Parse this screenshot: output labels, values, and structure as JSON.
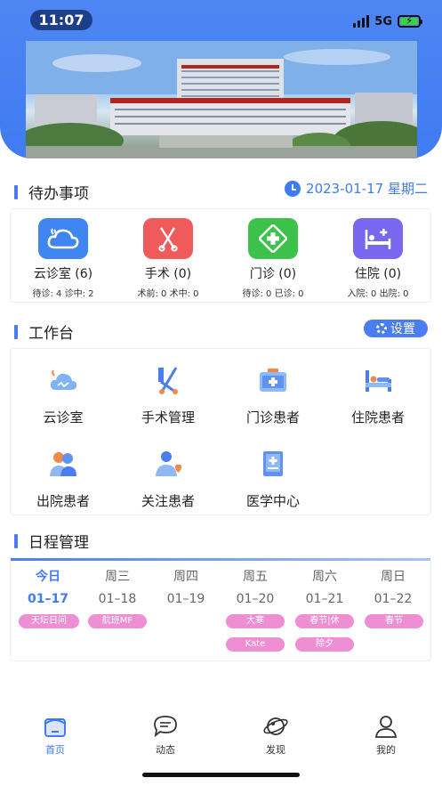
{
  "status_bar": {
    "time": "11:07",
    "network": "5G"
  },
  "todo": {
    "title": "待办事项",
    "date": "2023-01-17 星期二",
    "items": [
      {
        "name": "云诊室 (6)",
        "sub": "待诊: 4  诊中: 2",
        "color": "#3f86f3"
      },
      {
        "name": "手术 (0)",
        "sub": "术前: 0  术中: 0",
        "color": "#ef5b5b"
      },
      {
        "name": "门诊 (0)",
        "sub": "待诊: 0  已诊: 0",
        "color": "#3cc24a"
      },
      {
        "name": "住院 (0)",
        "sub": "入院: 0  出院: 0",
        "color": "#7a67f0"
      }
    ]
  },
  "workbench": {
    "title": "工作台",
    "settings_label": "设置",
    "items": [
      {
        "label": "云诊室",
        "icon": "cloud-icon"
      },
      {
        "label": "手术管理",
        "icon": "surgery-tools-icon"
      },
      {
        "label": "门诊患者",
        "icon": "medical-kit-icon"
      },
      {
        "label": "住院患者",
        "icon": "hospital-bed-icon"
      },
      {
        "label": "出院患者",
        "icon": "patients-icon"
      },
      {
        "label": "关注患者",
        "icon": "heart-patient-icon"
      },
      {
        "label": "医学中心",
        "icon": "medical-book-icon"
      }
    ]
  },
  "schedule": {
    "title": "日程管理",
    "days": [
      {
        "name": "今日",
        "date": "01–17",
        "today": true
      },
      {
        "name": "周三",
        "date": "01–18"
      },
      {
        "name": "周四",
        "date": "01–19"
      },
      {
        "name": "周五",
        "date": "01–20"
      },
      {
        "name": "周六",
        "date": "01–21"
      },
      {
        "name": "周日",
        "date": "01–22"
      }
    ],
    "tags": [
      "天坛日间",
      "航班MF",
      "大寒",
      "春节|休",
      "春节",
      "Kate",
      "除夕"
    ],
    "tag_color": "#ee8fd3"
  },
  "tabbar": {
    "items": [
      {
        "label": "首页",
        "active": true
      },
      {
        "label": "动态"
      },
      {
        "label": "发现"
      },
      {
        "label": "我的"
      }
    ]
  },
  "colors": {
    "accent": "#3f7bf2"
  }
}
